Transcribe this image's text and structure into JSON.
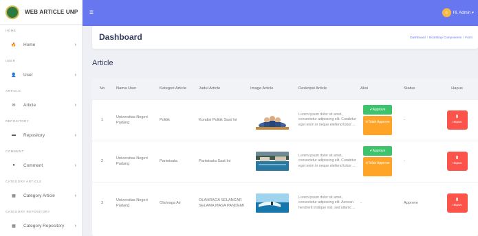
{
  "brand": {
    "name": "WEB ARTICLE UNP"
  },
  "sidebar": {
    "sections": [
      {
        "header": "HOME",
        "label": "Home",
        "icon": "fire-icon",
        "glyph": "🔥"
      },
      {
        "header": "USER",
        "label": "User",
        "icon": "user-icon",
        "glyph": "👤"
      },
      {
        "header": "ARTICLE",
        "label": "Article",
        "icon": "envelope-icon",
        "glyph": "✉"
      },
      {
        "header": "REPOSITORY",
        "label": "Repository",
        "icon": "folder-icon",
        "glyph": "▬"
      },
      {
        "header": "COMMENT",
        "label": "Comment",
        "icon": "comment-icon",
        "glyph": "●"
      },
      {
        "header": "CATEGORY ARTICLE",
        "label": "Category Article",
        "icon": "list-icon",
        "glyph": "▦"
      },
      {
        "header": "CATEGORY REPOSITORY",
        "label": "Category Repository",
        "icon": "list-icon",
        "glyph": "▦"
      }
    ],
    "chevron": "›"
  },
  "topbar": {
    "menu_glyph": "≡",
    "user_label": "Hi, Admin ▾"
  },
  "header": {
    "title": "Dashboard",
    "breadcrumbs": [
      "Dashboard",
      "Bootstrap Components",
      "Form"
    ]
  },
  "section": {
    "title": "Article"
  },
  "table": {
    "columns": [
      "No",
      "Nama User",
      "Kategori Article",
      "Judul Article",
      "Image Article",
      "Deskripsi Article",
      "Aksi",
      "Status",
      "Hapus"
    ],
    "rows": [
      {
        "no": "1",
        "user": "Universitas Negeri Padang",
        "kategori": "Politik",
        "judul": "Kondisi Politik Saat Ini",
        "deskripsi": "Lorem ipsum dolor sit amet, consectetur adipiscing elit. Curabitur eget enim in neque eleifend tobor ...",
        "approve": "✔Approve",
        "tolak": "⊘Tolak Approve",
        "status": "-",
        "hapus": "Hapus",
        "aksi": ""
      },
      {
        "no": "2",
        "user": "Universitas Negeri Padang",
        "kategori": "Pariwisata",
        "judul": "Pariwisata Saat Ini",
        "deskripsi": "Lorem ipsum dolor sit amet, consectetur adipiscing elit. Curabitur eget enim in neque eleifend tobor ...",
        "approve": "✔Approve",
        "tolak": "⊘Tolak Approve",
        "status": "-",
        "hapus": "Hapus",
        "aksi": ""
      },
      {
        "no": "3",
        "user": "Universitas Negeri Padang",
        "kategori": "Olahraga Air",
        "judul": "OLAHRAGA SELANCAR SELAMA MASA PANDEMI",
        "deskripsi": "Lorem ipsum dolor sit amet, consectetur adipiscing elit. Aenean hendrerit tristique nisl, sed ullamc ...",
        "approve": "",
        "tolak": "",
        "status": "Approve",
        "hapus": "Hapus",
        "aksi": "-"
      }
    ]
  },
  "colors": {
    "primary": "#6777ef",
    "success": "#3cc36b",
    "warning": "#ffa426",
    "danger": "#fc544b"
  }
}
